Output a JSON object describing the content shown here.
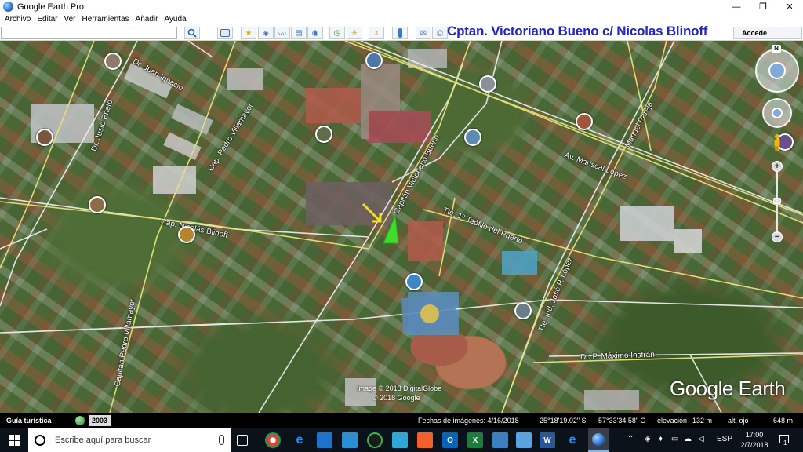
{
  "window": {
    "title": "Google Earth Pro",
    "controls": [
      "—",
      "❐",
      "✕"
    ]
  },
  "menu": [
    "Archivo",
    "Editar",
    "Ver",
    "Herramientas",
    "Añadir",
    "Ayuda"
  ],
  "toolbar": {
    "search_value": "",
    "place_title": "Cptan. Victoriano Bueno c/ Nicolas Blinoff",
    "sign_in": "Accede"
  },
  "map": {
    "street_labels": [
      "Dr. Juan Ignacio",
      "Cap. Pedro Villamayor",
      "Cap. Nicolás Blinoff",
      "Capitán Victoriano Bueno",
      "Tte. 1º Teófilo del Puerto",
      "Av. Mariscal López",
      "Manuel Pareja",
      "Tte. Ind. José P. López",
      "Dr. P. Máximo Insfrán",
      "Capitán Pedro Villamayor",
      "Dr. Justo Prieto"
    ],
    "copyright_lines": [
      "Image © 2018 DigitalGlobe",
      "© 2018 Google"
    ],
    "logo": "Google Earth",
    "compass_letter": "N",
    "zoom_in": "+",
    "zoom_out": "−"
  },
  "status": {
    "tour_label": "Guía turística",
    "year": "2003",
    "imagery_date": "Fechas de imágenes: 4/16/2018",
    "lat": "25°18'19.02\" S",
    "lon": "57°33'34.58\" O",
    "elevation": "elevación",
    "elevation_value": "132 m",
    "eye_alt": "alt. ojo",
    "eye_alt_value": "648 m"
  },
  "taskbar": {
    "search_placeholder": "Escribe aquí para buscar",
    "language": "ESP",
    "time": "17:00",
    "date": "2/7/2018",
    "notifications": "1"
  },
  "colors": {
    "place_title": "#2323c8",
    "street_line": "#e8e27a",
    "boundary_line": "#f2f2f2",
    "pin_arrow": "#f0e020",
    "view_marker": "#3fdc2a"
  }
}
